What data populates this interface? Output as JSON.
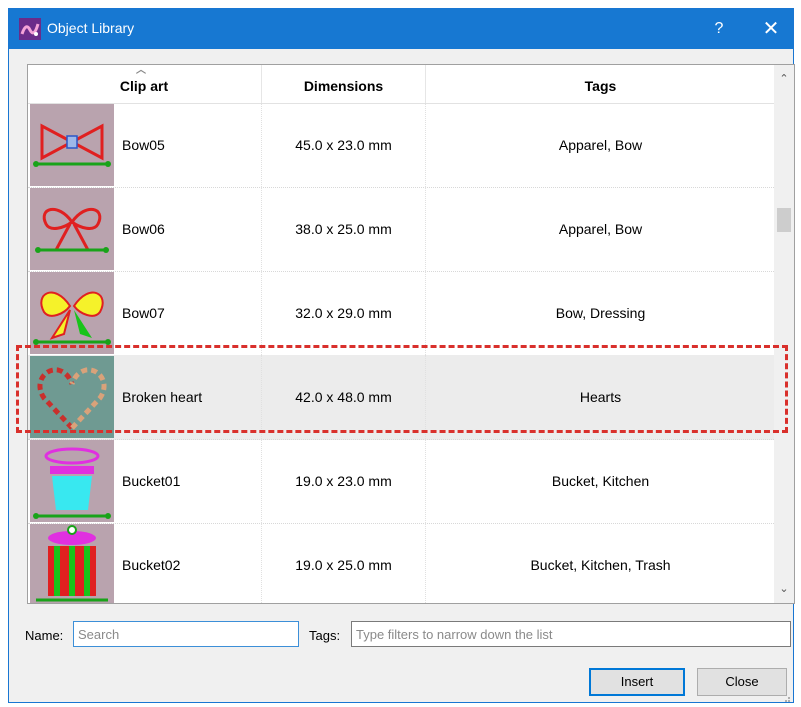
{
  "window": {
    "title": "Object Library",
    "help_label": "?",
    "close_label": "✕"
  },
  "columns": {
    "clipart": "Clip art",
    "dimensions": "Dimensions",
    "tags": "Tags"
  },
  "rows": [
    {
      "name": "Bow05",
      "dimensions": "45.0 x 23.0 mm",
      "tags": "Apparel, Bow",
      "thumbnail_icon": "bow-outline-icon"
    },
    {
      "name": "Bow06",
      "dimensions": "38.0 x 25.0 mm",
      "tags": "Apparel, Bow",
      "thumbnail_icon": "ribbon-bow-icon"
    },
    {
      "name": "Bow07",
      "dimensions": "32.0 x 29.0 mm",
      "tags": "Bow, Dressing",
      "thumbnail_icon": "yellow-bow-icon"
    },
    {
      "name": "Broken heart",
      "dimensions": "42.0 x 48.0 mm",
      "tags": "Hearts",
      "thumbnail_icon": "broken-heart-icon",
      "selected": true
    },
    {
      "name": "Bucket01",
      "dimensions": "19.0 x 23.0 mm",
      "tags": "Bucket, Kitchen",
      "thumbnail_icon": "bucket-icon"
    },
    {
      "name": "Bucket02",
      "dimensions": "19.0 x 25.0 mm",
      "tags": "Bucket, Kitchen, Trash",
      "thumbnail_icon": "trash-bucket-icon"
    }
  ],
  "filters": {
    "name_label": "Name:",
    "name_placeholder": "Search",
    "tags_label": "Tags:",
    "tags_placeholder": "Type filters to narrow down the list"
  },
  "buttons": {
    "insert": "Insert",
    "close": "Close"
  },
  "colors": {
    "titlebar": "#1778d2",
    "highlight_dashed": "#d9302c",
    "thumbnail_bg": "#b9a3ae",
    "thumbnail_selected_bg": "#6f9a92"
  }
}
